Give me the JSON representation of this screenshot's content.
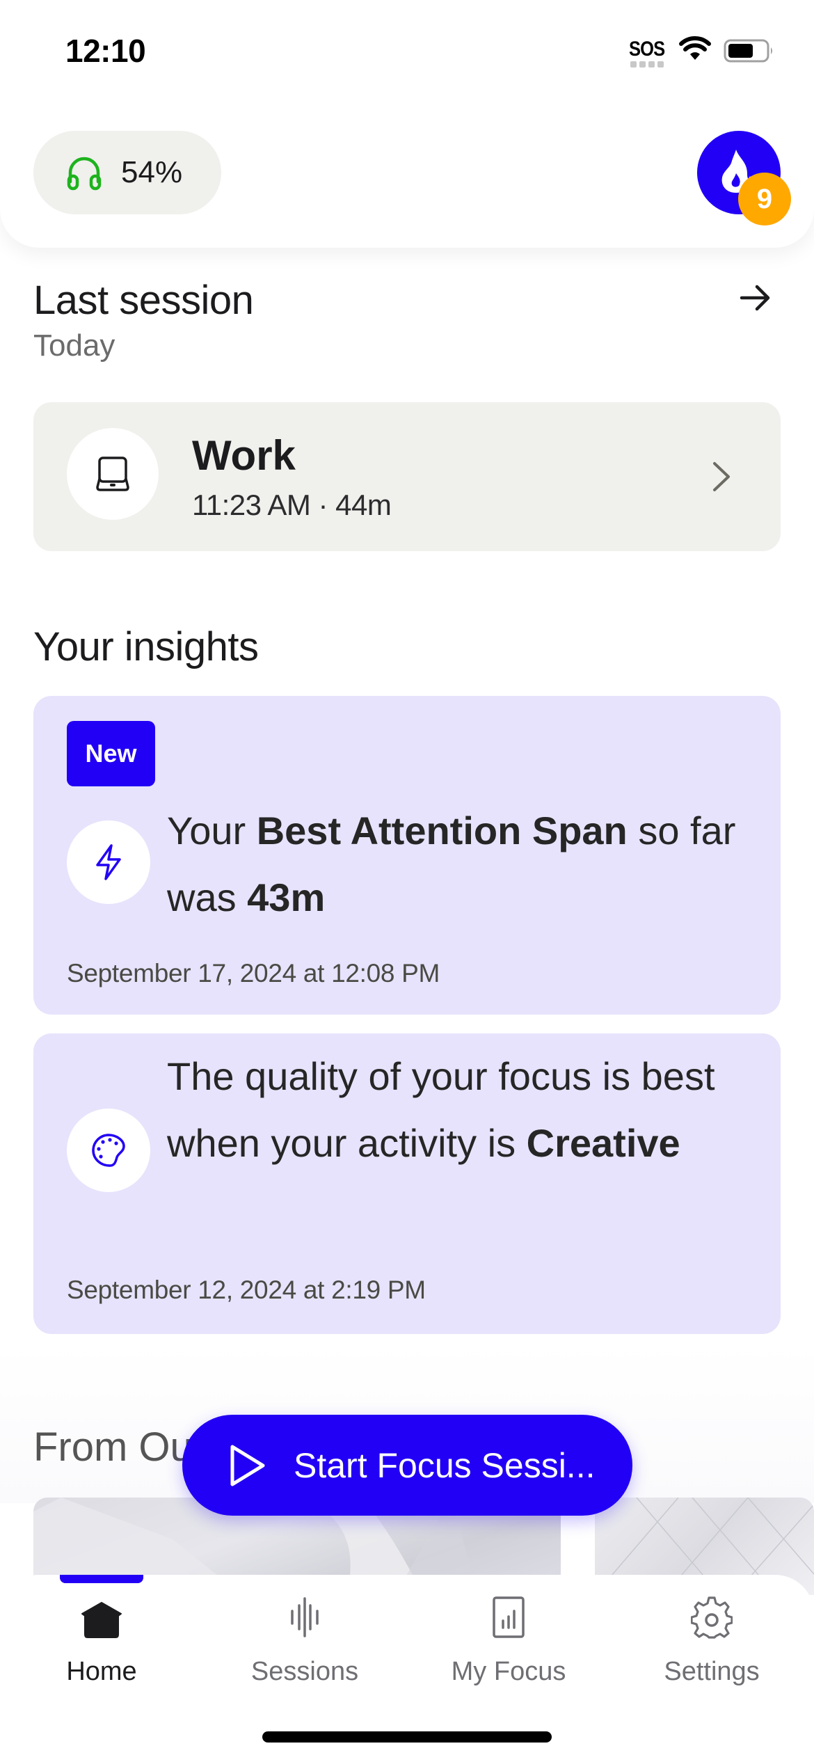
{
  "status_bar": {
    "time": "12:10",
    "carrier": "SOS",
    "wifi_icon": "wifi-icon",
    "battery_icon": "battery-icon"
  },
  "header": {
    "headphone_battery": {
      "icon": "headphones-icon",
      "value": "54%",
      "color": "#1db31d"
    },
    "streak": {
      "icon": "flame-icon",
      "count": "9",
      "color": "#2200f5",
      "badge_color": "#ffa800"
    }
  },
  "last_session": {
    "title": "Last session",
    "subtitle": "Today",
    "arrow_icon": "arrow-right-icon",
    "card": {
      "icon": "laptop-icon",
      "activity": "Work",
      "meta": "11:23 AM · 44m",
      "chevron_icon": "chevron-right-icon"
    }
  },
  "insights": {
    "title": "Your insights",
    "items": [
      {
        "badge": "New",
        "icon": "lightning-icon",
        "text_parts": [
          "Your ",
          "Best Attention Span",
          " so far was ",
          "43m"
        ],
        "date": "September 17, 2024 at 12:08 PM"
      },
      {
        "icon": "palette-icon",
        "text_parts": [
          "The quality of your focus is best when your activity is ",
          "Creative"
        ],
        "date": "September 12, 2024 at 2:19 PM"
      }
    ]
  },
  "from_our": {
    "title": "From Our"
  },
  "fab": {
    "icon": "play-icon",
    "label": "Start Focus Sessi..."
  },
  "bottom_nav": {
    "items": [
      {
        "label": "Home",
        "icon": "home-icon",
        "active": true
      },
      {
        "label": "Sessions",
        "icon": "sound-wave-icon",
        "active": false
      },
      {
        "label": "My Focus",
        "icon": "chart-icon",
        "active": false
      },
      {
        "label": "Settings",
        "icon": "gear-icon",
        "active": false
      }
    ]
  },
  "colors": {
    "accent": "#2200f5",
    "insight_bg": "#e7e3fc",
    "card_bg": "#f0f0ed"
  }
}
